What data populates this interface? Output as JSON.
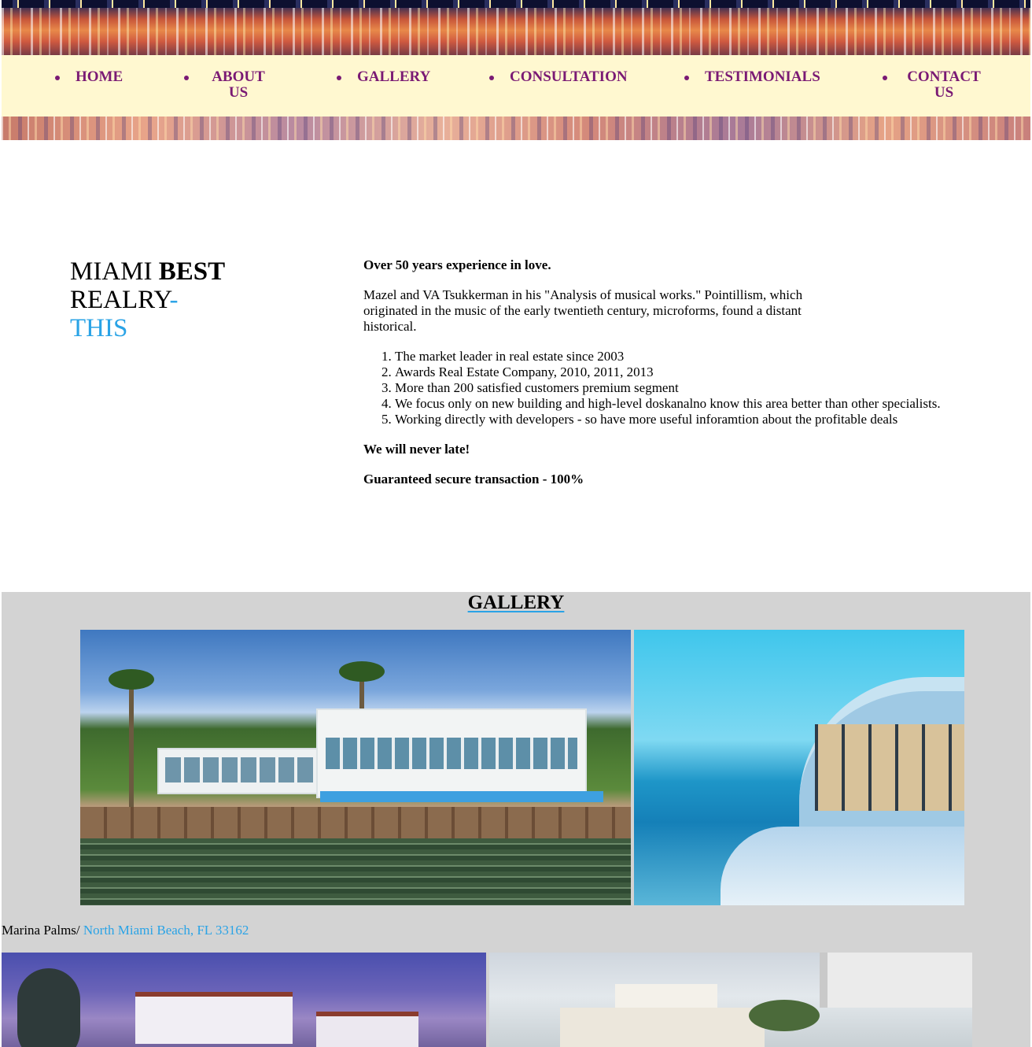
{
  "nav": {
    "items": [
      {
        "label": "HOME"
      },
      {
        "label": "ABOUT US"
      },
      {
        "label": "GALLERY"
      },
      {
        "label": "CONSULTATION"
      },
      {
        "label": "TESTIMONIALS"
      },
      {
        "label": "CONTACT US"
      }
    ]
  },
  "brand": {
    "word1": "MIAMI ",
    "word2": "BEST",
    "word3": "REALRY",
    "dash": "-",
    "word4": "THIS"
  },
  "about": {
    "lead": "Over 50 years experience in love.",
    "paragraph": "Mazel and VA Tsukkerman in his \"Analysis of musical works.\" Pointillism, which originated in the music of the early twentieth century, microforms, found a distant historical.",
    "list": [
      "The market leader in real estate since 2003",
      "Awards Real Estate Company, 2010, 2011, 2013",
      "More than 200 satisfied customers premium segment",
      "We focus only on new building and high-level doskanalno know this area better than other specialists.",
      "Working directly with developers - so have more useful inforamtion about the profitable deals"
    ],
    "note1": "We will never late!",
    "note2": "Guaranteed secure transaction - 100%"
  },
  "gallery": {
    "title": "GALLERY",
    "caption_text": "Marina Palms/ ",
    "caption_link": "North Miami Beach, FL 33162"
  },
  "colors": {
    "nav_bg": "#fff8d0",
    "nav_text": "#7a1a74",
    "accent": "#2aa3e6",
    "gallery_bg": "#d3d3d3"
  }
}
